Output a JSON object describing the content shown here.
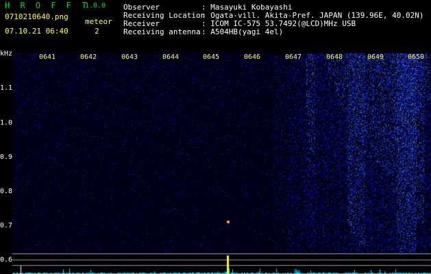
{
  "header": {
    "app_name": "H R O F F T",
    "app_version": "1.0.0",
    "filename": "0710210640.png",
    "meteor_label": "meteor",
    "datetime": "07.10.21 06:40",
    "meteor_count": "2"
  },
  "info": {
    "observer_key": "Observer",
    "observer_val": ": Masayuki Kobayashi",
    "location_key": "Receiving Location",
    "location_val": ": Ogata-vill. Akita-Pref. JAPAN (139.96E, 40.02N)",
    "receiver_key": "Receiver",
    "receiver_val": ": ICOM IC-575 53.7492(@LCD)MHz USB",
    "antenna_key": "Receiving antenna",
    "antenna_val": ": A504HB(yagi 4el)"
  },
  "axis": {
    "unit": "kHz",
    "y_ticks": [
      "1.1",
      "1.0",
      "0.9",
      "0.8",
      "0.7",
      "0.6"
    ],
    "time_ticks": [
      "0641",
      "0642",
      "0643",
      "0644",
      "0645",
      "0646",
      "0647",
      "0648",
      "0649",
      "0650"
    ]
  },
  "colors": {
    "background": "#000000",
    "title_green": "#00e020",
    "tick_yellow": "#ffff40",
    "noise_blue": "#2040ff",
    "level_cyan": "#00e0ff"
  }
}
